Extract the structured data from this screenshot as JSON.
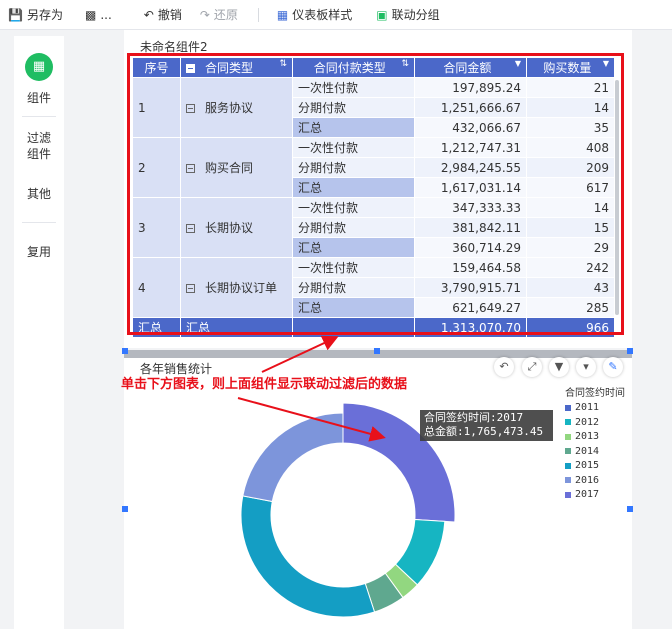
{
  "toolbar": {
    "save_as": "另存为",
    "more": "...",
    "undo": "撤销",
    "redo": "还原",
    "dashboard_style": "仪表板样式",
    "linkage_group": "联动分组"
  },
  "sidebar": {
    "items": [
      "组件",
      "过滤\n组件",
      "其他",
      "复用"
    ]
  },
  "widget1": {
    "title": "未命名组件2",
    "headers": [
      "序号",
      "合同类型",
      "合同付款类型",
      "合同金额",
      "购买数量"
    ],
    "groups": [
      {
        "index": "1",
        "type": "服务协议",
        "rows": [
          {
            "pay": "一次性付款",
            "amount": "197,895.24",
            "qty": "21"
          },
          {
            "pay": "分期付款",
            "amount": "1,251,666.67",
            "qty": "14"
          },
          {
            "pay": "汇总",
            "amount": "432,066.67",
            "qty": "35"
          }
        ]
      },
      {
        "index": "2",
        "type": "购买合同",
        "rows": [
          {
            "pay": "一次性付款",
            "amount": "1,212,747.31",
            "qty": "408"
          },
          {
            "pay": "分期付款",
            "amount": "2,984,245.55",
            "qty": "209"
          },
          {
            "pay": "汇总",
            "amount": "1,617,031.14",
            "qty": "617"
          }
        ]
      },
      {
        "index": "3",
        "type": "长期协议",
        "rows": [
          {
            "pay": "一次性付款",
            "amount": "347,333.33",
            "qty": "14"
          },
          {
            "pay": "分期付款",
            "amount": "381,842.11",
            "qty": "15"
          },
          {
            "pay": "汇总",
            "amount": "360,714.29",
            "qty": "29"
          }
        ]
      },
      {
        "index": "4",
        "type": "长期协议订单",
        "rows": [
          {
            "pay": "一次性付款",
            "amount": "159,464.58",
            "qty": "242"
          },
          {
            "pay": "分期付款",
            "amount": "3,790,915.71",
            "qty": "43"
          },
          {
            "pay": "汇总",
            "amount": "621,649.27",
            "qty": "285"
          }
        ]
      }
    ],
    "total": {
      "label1": "汇总",
      "label2": "汇总",
      "amount": "1,313,070.70",
      "qty": "966"
    }
  },
  "widget2": {
    "title": "各年销售统计",
    "annotation": "单击下方图表，则上面组件显示联动过滤后的数据",
    "tooltip": {
      "line1": "合同签约时间:2017",
      "line2": "总金额:1,765,473.45"
    }
  },
  "chart_data": {
    "type": "pie",
    "legend_title": "合同签约时间",
    "categories": [
      "2011",
      "2012",
      "2013",
      "2014",
      "2015",
      "2016",
      "2017"
    ],
    "colors": [
      "#4b68c9",
      "#16b5c2",
      "#92d780",
      "#5fa88f",
      "#149ec4",
      "#7d95db",
      "#6a6fd8"
    ],
    "shares": [
      0.0,
      0.11,
      0.03,
      0.05,
      0.33,
      0.22,
      0.26
    ],
    "highlight": "2017"
  },
  "icons": {
    "save": "save-icon",
    "archive": "archive-icon",
    "undo": "undo-icon",
    "redo": "redo-icon",
    "style": "grid-icon",
    "linkage": "linkage-icon"
  }
}
